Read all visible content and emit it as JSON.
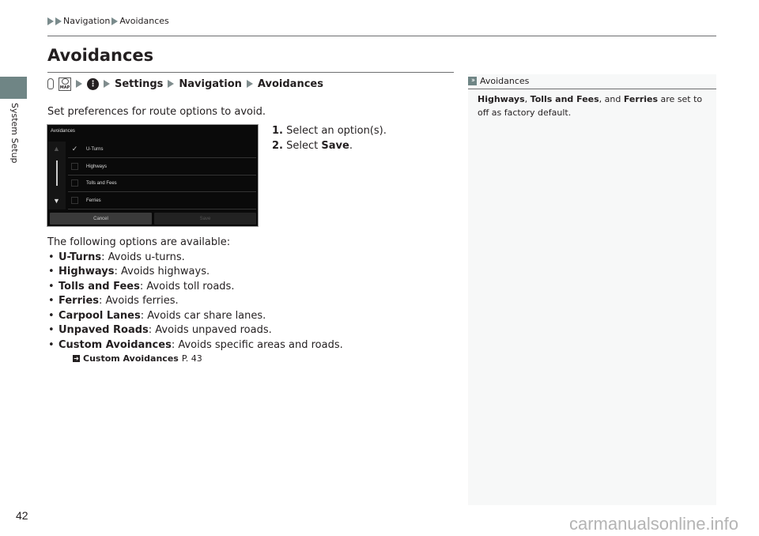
{
  "breadcrumb": {
    "items": [
      "Navigation",
      "Avoidances"
    ]
  },
  "side_tab": {
    "label": "System Setup",
    "color": "#6f8585"
  },
  "page": {
    "title": "Avoidances",
    "number": "42"
  },
  "path": {
    "icons": [
      "home-icon",
      "map-button-icon",
      "menu-icon"
    ],
    "items": [
      "Settings",
      "Navigation",
      "Avoidances"
    ]
  },
  "intro": "Set preferences for route options to avoid.",
  "screen": {
    "title": "Avoidances",
    "options": [
      {
        "label": "U-Turns",
        "checked": true
      },
      {
        "label": "Highways",
        "checked": false
      },
      {
        "label": "Tolls and Fees",
        "checked": false
      },
      {
        "label": "Ferries",
        "checked": false
      }
    ],
    "cancel_label": "Cancel",
    "save_label": "Save"
  },
  "steps": [
    {
      "num": "1.",
      "text": "Select an option(s).",
      "bold": ""
    },
    {
      "num": "2.",
      "text": "Select ",
      "bold": "Save",
      "suffix": "."
    }
  ],
  "available": {
    "heading": "The following options are available:",
    "items": [
      {
        "term": "U-Turns",
        "desc": ": Avoids u-turns."
      },
      {
        "term": "Highways",
        "desc": ": Avoids highways."
      },
      {
        "term": "Tolls and Fees",
        "desc": ": Avoids toll roads."
      },
      {
        "term": "Ferries",
        "desc": ": Avoids ferries."
      },
      {
        "term": "Carpool Lanes",
        "desc": ": Avoids car share lanes."
      },
      {
        "term": "Unpaved Roads",
        "desc": ": Avoids unpaved roads."
      },
      {
        "term": "Custom Avoidances",
        "desc": ": Avoids specific areas and roads."
      }
    ]
  },
  "xref": {
    "label": "Custom Avoidances",
    "page": "P. 43"
  },
  "note": {
    "title": "Avoidances",
    "b1": "Highways",
    "t1": ", ",
    "b2": "Tolls and Fees",
    "t2": ", and ",
    "b3": "Ferries",
    "t3": " are set to off as factory default."
  },
  "watermark": "carmanualsonline.info"
}
